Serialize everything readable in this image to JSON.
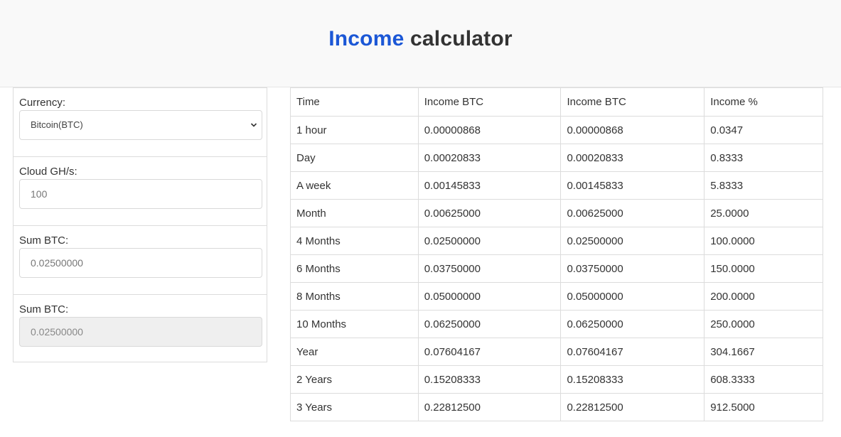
{
  "header": {
    "title_accent": "Income",
    "title_rest": "calculator"
  },
  "form": {
    "currency": {
      "label": "Currency:",
      "value": "Bitcoin(BTC)"
    },
    "cloud": {
      "label": "Cloud GH/s:",
      "placeholder": "100"
    },
    "sum": {
      "label": "Sum BTC:",
      "placeholder": "0.02500000"
    },
    "sum_readonly": {
      "label": "Sum BTC:",
      "value": "0.02500000"
    }
  },
  "table": {
    "headers": [
      "Time",
      "Income BTC",
      "Income BTC",
      "Income %"
    ],
    "rows": [
      [
        "1 hour",
        "0.00000868",
        "0.00000868",
        "0.0347"
      ],
      [
        "Day",
        "0.00020833",
        "0.00020833",
        "0.8333"
      ],
      [
        "A week",
        "0.00145833",
        "0.00145833",
        "5.8333"
      ],
      [
        "Month",
        "0.00625000",
        "0.00625000",
        "25.0000"
      ],
      [
        "4 Months",
        "0.02500000",
        "0.02500000",
        "100.0000"
      ],
      [
        "6 Months",
        "0.03750000",
        "0.03750000",
        "150.0000"
      ],
      [
        "8 Months",
        "0.05000000",
        "0.05000000",
        "200.0000"
      ],
      [
        "10 Months",
        "0.06250000",
        "0.06250000",
        "250.0000"
      ],
      [
        "Year",
        "0.07604167",
        "0.07604167",
        "304.1667"
      ],
      [
        "2 Years",
        "0.15208333",
        "0.15208333",
        "608.3333"
      ],
      [
        "3 Years",
        "0.22812500",
        "0.22812500",
        "912.5000"
      ]
    ]
  },
  "icons": {
    "select_chevron": "chevron-down-icon"
  }
}
